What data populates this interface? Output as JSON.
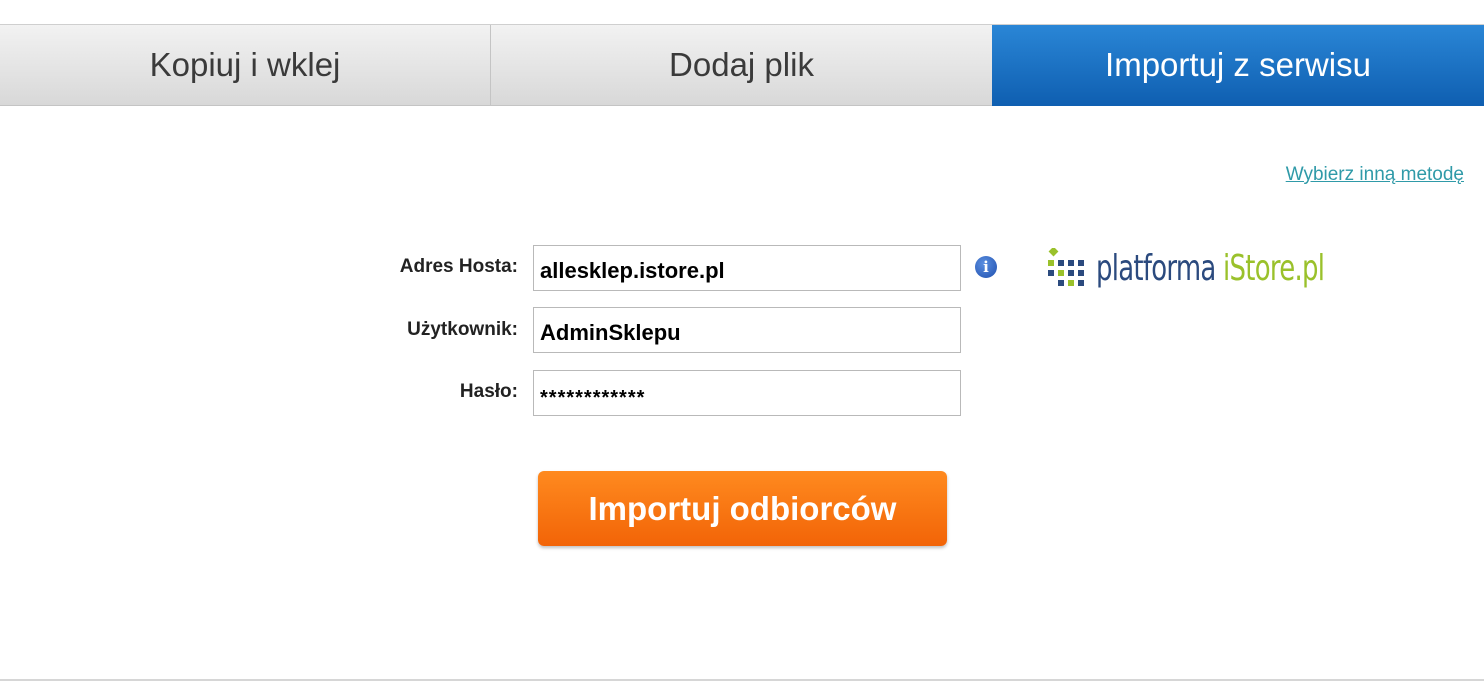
{
  "tabs": [
    {
      "label": "Kopiuj i wklej",
      "active": false
    },
    {
      "label": "Dodaj plik",
      "active": false
    },
    {
      "label": "Importuj z serwisu",
      "active": true
    }
  ],
  "other_method_link": "Wybierz inną metodę",
  "form": {
    "host": {
      "label": "Adres Hosta:",
      "value": "allesklep.istore.pl"
    },
    "user": {
      "label": "Użytkownik:",
      "value": "AdminSklepu"
    },
    "password": {
      "label": "Hasło:",
      "value": "************"
    }
  },
  "info_icon": "info-icon",
  "logo": {
    "part1": "platforma ",
    "part2": "iStore.pl"
  },
  "submit_label": "Importuj odbiorców",
  "colors": {
    "active_tab": "#1a6fc4",
    "inactive_tab": "#e3e3e3",
    "link": "#2f9aa8",
    "button": "#f57415",
    "logo_blue": "#2b4a7e",
    "logo_green": "#9ac12b"
  }
}
